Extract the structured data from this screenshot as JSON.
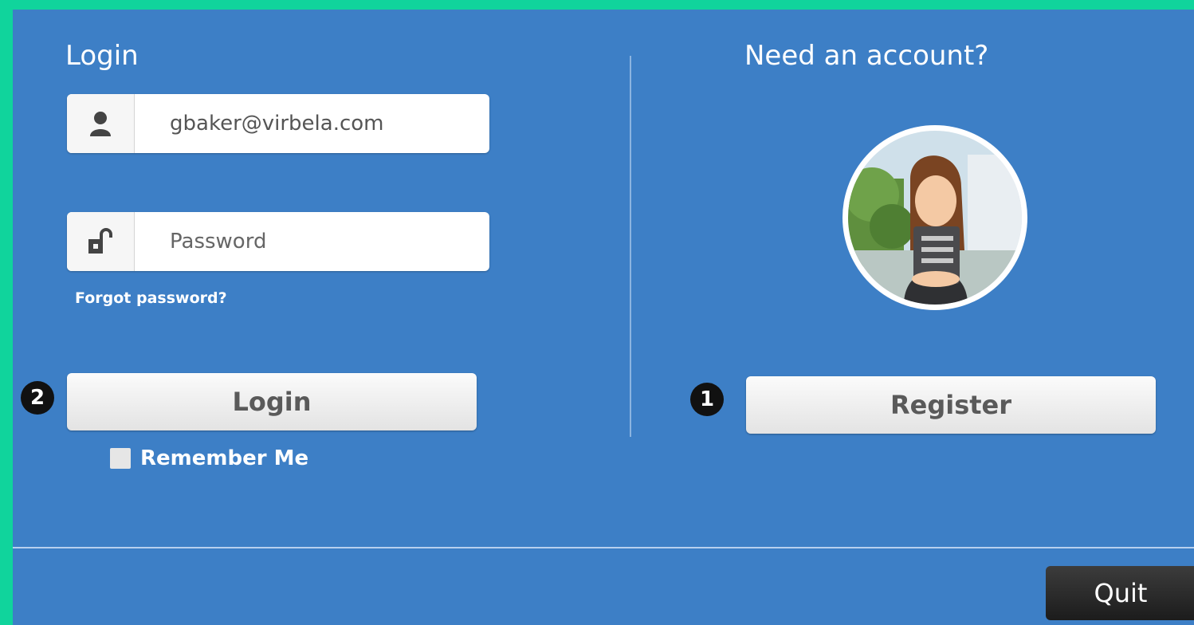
{
  "login": {
    "title": "Login",
    "username_value": "gbaker@virbela.com",
    "password_placeholder": "Password",
    "forgot_link": "Forgot password?",
    "button_label": "Login",
    "badge": "2",
    "remember_label": "Remember Me",
    "user_icon": "user-icon",
    "lock_icon": "unlocked-padlock-icon"
  },
  "register": {
    "title": "Need an account?",
    "button_label": "Register",
    "badge": "1",
    "avatar": "avatar-woman-with-clipboard"
  },
  "footer": {
    "quit_label": "Quit"
  },
  "colors": {
    "background": "#3d7fc6",
    "frame": "#10d49c",
    "button": "#f0f0f0",
    "quit_button": "#2a2a2a"
  }
}
